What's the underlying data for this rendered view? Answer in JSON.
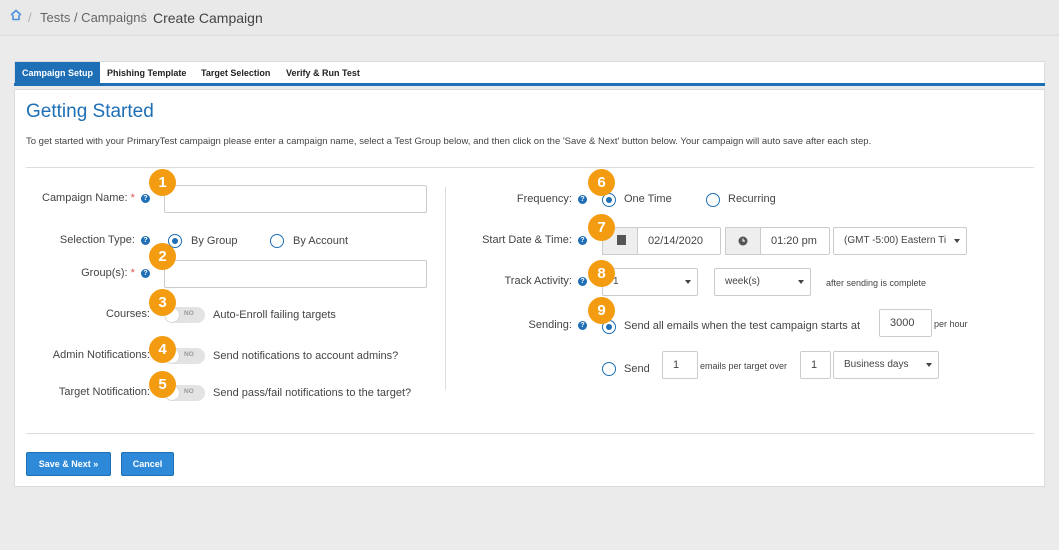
{
  "breadcrumb": {
    "parent": "Tests / Campaigns",
    "current": "Create Campaign"
  },
  "tabs": [
    {
      "label": "Campaign Setup"
    },
    {
      "label": "Phishing Template"
    },
    {
      "label": "Target Selection"
    },
    {
      "label": "Verify & Run Test"
    }
  ],
  "page": {
    "title": "Getting Started",
    "intro": "To get started with your PrimaryTest campaign please enter a campaign name, select a Test Group below, and then click on the 'Save & Next' button below. Your campaign will auto save after each step."
  },
  "left": {
    "campaign_name_label": "Campaign Name:",
    "campaign_name_value": "",
    "selection_type_label": "Selection Type:",
    "by_group": "By Group",
    "by_account": "By Account",
    "groups_label": "Group(s):",
    "groups_value": "",
    "courses_label": "Courses:",
    "courses_text": "Auto-Enroll failing targets",
    "admin_label": "Admin Notifications:",
    "admin_text": "Send notifications to account admins?",
    "target_label": "Target Notification:",
    "target_text": "Send pass/fail notifications to the target?",
    "toggle_off": "NO",
    "required_mark": "*"
  },
  "right": {
    "frequency_label": "Frequency:",
    "one_time": "One Time",
    "recurring": "Recurring",
    "start_label": "Start Date & Time:",
    "date_value": "02/14/2020",
    "time_value": "01:20 pm",
    "timezone_value": "(GMT -5:00) Eastern Ti",
    "track_label": "Track Activity:",
    "track_count": "1",
    "track_unit": "week(s)",
    "track_after": "after sending is complete",
    "sending_label": "Sending:",
    "send_all_text": "Send all emails when the test campaign starts at",
    "send_all_value": "3000",
    "per_hour": "per hour",
    "send_text": "Send",
    "send_count": "1",
    "emails_per_target": "emails per target over",
    "days_count": "1",
    "days_unit": "Business days"
  },
  "steps": [
    "1",
    "2",
    "3",
    "4",
    "5",
    "6",
    "7",
    "8",
    "9"
  ],
  "buttons": {
    "save_next": "Save & Next »",
    "cancel": "Cancel"
  },
  "colors": {
    "primary": "#1e6fb5",
    "badge": "#f39c12",
    "required": "#d9534f"
  }
}
